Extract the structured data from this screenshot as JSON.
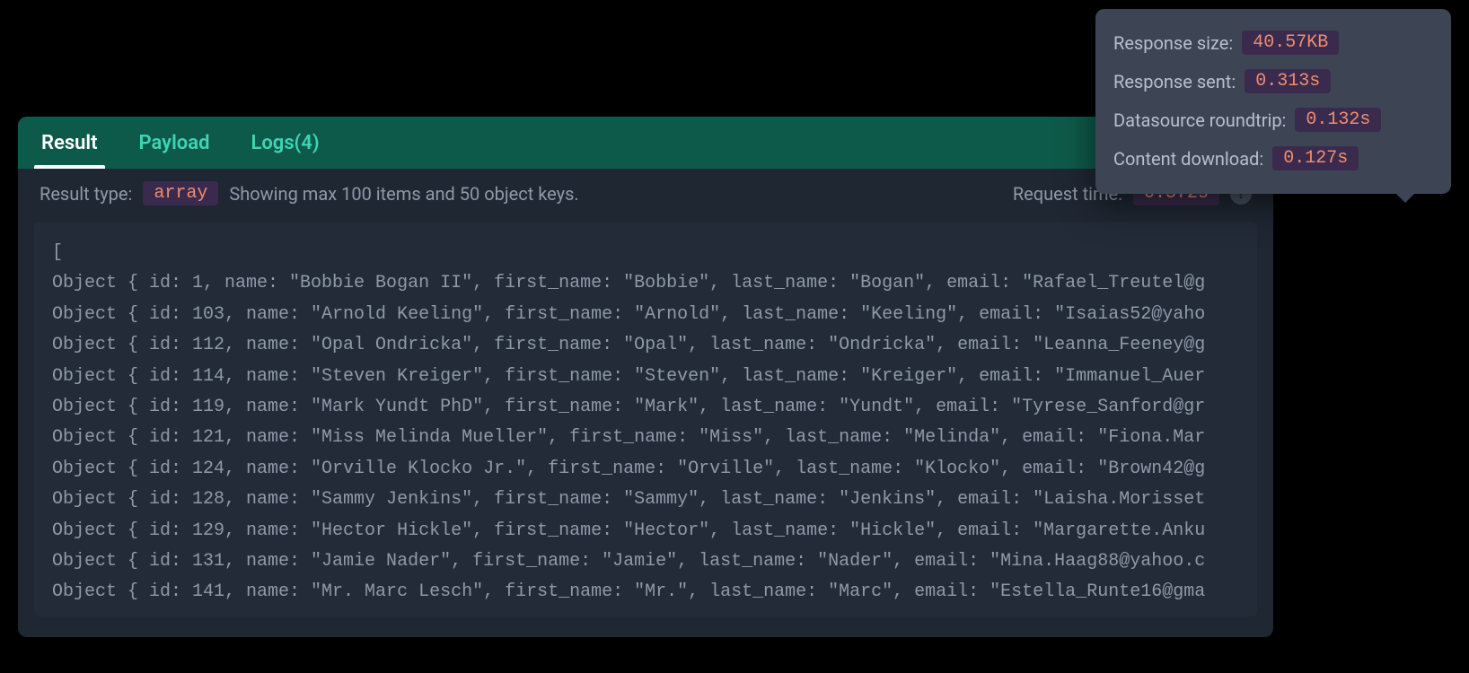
{
  "tabs": {
    "result": "Result",
    "payload": "Payload",
    "logs": "Logs(4)"
  },
  "info": {
    "resultTypeLabel": "Result type:",
    "resultTypeValue": "array",
    "showing": "Showing max 100 items and 50 object keys.",
    "requestTimeLabel": "Request time:",
    "requestTimeValue": "0.572s",
    "helpGlyph": "?"
  },
  "tooltip": {
    "rows": [
      {
        "label": "Response size:",
        "value": "40.57KB"
      },
      {
        "label": "Response sent:",
        "value": "0.313s"
      },
      {
        "label": "Datasource roundtrip:",
        "value": "0.132s"
      },
      {
        "label": "Content download:",
        "value": "0.127s"
      }
    ]
  },
  "result": {
    "open": "[",
    "rows": [
      {
        "id": 1,
        "name": "Bobbie Bogan II",
        "first_name": "Bobbie",
        "last_name": "Bogan",
        "email_prefix": "Rafael_Treutel@g"
      },
      {
        "id": 103,
        "name": "Arnold Keeling",
        "first_name": "Arnold",
        "last_name": "Keeling",
        "email_prefix": "Isaias52@yaho"
      },
      {
        "id": 112,
        "name": "Opal Ondricka",
        "first_name": "Opal",
        "last_name": "Ondricka",
        "email_prefix": "Leanna_Feeney@g"
      },
      {
        "id": 114,
        "name": "Steven Kreiger",
        "first_name": "Steven",
        "last_name": "Kreiger",
        "email_prefix": "Immanuel_Auer"
      },
      {
        "id": 119,
        "name": "Mark Yundt PhD",
        "first_name": "Mark",
        "last_name": "Yundt",
        "email_prefix": "Tyrese_Sanford@gr"
      },
      {
        "id": 121,
        "name": "Miss Melinda Mueller",
        "first_name": "Miss",
        "last_name": "Melinda",
        "email_prefix": "Fiona.Mar"
      },
      {
        "id": 124,
        "name": "Orville Klocko Jr.",
        "first_name": "Orville",
        "last_name": "Klocko",
        "email_prefix": "Brown42@g"
      },
      {
        "id": 128,
        "name": "Sammy Jenkins",
        "first_name": "Sammy",
        "last_name": "Jenkins",
        "email_prefix": "Laisha.Morisset"
      },
      {
        "id": 129,
        "name": "Hector Hickle",
        "first_name": "Hector",
        "last_name": "Hickle",
        "email_prefix": "Margarette.Anku"
      },
      {
        "id": 131,
        "name": "Jamie Nader",
        "first_name": "Jamie",
        "last_name": "Nader",
        "email_prefix": "Mina.Haag88@yahoo.c"
      },
      {
        "id": 141,
        "name": "Mr. Marc Lesch",
        "first_name": "Mr.",
        "last_name": "Marc",
        "email_prefix": "Estella_Runte16@gma"
      }
    ]
  }
}
